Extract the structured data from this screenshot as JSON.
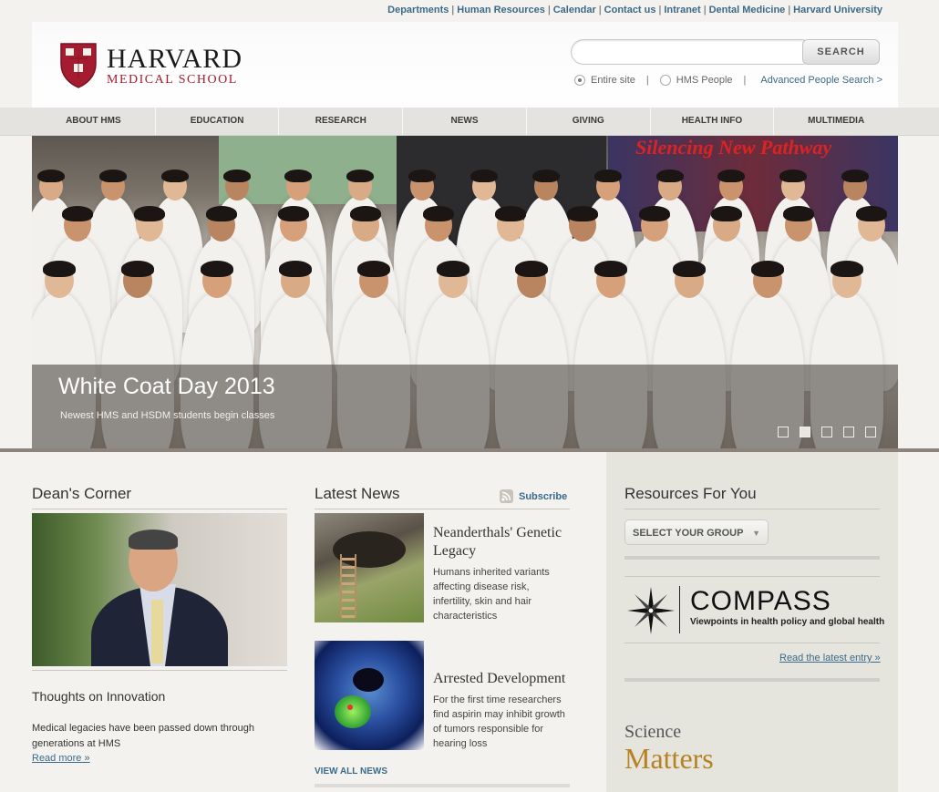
{
  "utility_links": [
    "Departments",
    "Human Resources",
    "Calendar",
    "Contact us",
    "Intranet",
    "Dental Medicine",
    "Harvard University"
  ],
  "logo": {
    "line1": "HARVARD",
    "line2": "MEDICAL SCHOOL",
    "shield_text": "VE RI TAS"
  },
  "search": {
    "placeholder": "",
    "button": "SEARCH",
    "scope_entire": "Entire site",
    "scope_people": "HMS People",
    "advanced": "Advanced People Search >"
  },
  "nav": [
    "ABOUT HMS",
    "EDUCATION",
    "RESEARCH",
    "NEWS",
    "GIVING",
    "HEALTH INFO",
    "MULTIMEDIA"
  ],
  "hero": {
    "title": "White Coat Day 2013",
    "subtitle": "Newest HMS and HSDM students begin classes",
    "banner_text": "Silencing New Pathway",
    "slide_count": 5,
    "active_slide": 2
  },
  "deans_corner": {
    "title": "Dean's Corner",
    "subtitle": "Thoughts on Innovation",
    "text": "Medical legacies have been passed down through generations at HMS",
    "link": "Read more »"
  },
  "latest_news": {
    "title": "Latest News",
    "subscribe": "Subscribe",
    "items": [
      {
        "headline": "Neanderthals' Genetic Legacy",
        "text": "Humans inherited variants affecting disease risk, infertility, skin and hair characteristics"
      },
      {
        "headline": "Arrested Development",
        "text": "For the first time researchers find aspirin may inhibit growth of tumors responsible for hearing loss"
      }
    ],
    "view_all": "VIEW ALL NEWS"
  },
  "resources": {
    "title": "Resources For You",
    "select": "SELECT YOUR GROUP",
    "compass_word": "COMPASS",
    "compass_tag": "Viewpoints in health policy and global health",
    "latest_entry": "Read the latest entry »",
    "science_line1": "Science",
    "science_line2": "Matters"
  },
  "colors": {
    "crimson": "#a51c30",
    "link": "#3a6b8c",
    "gold": "#b78223"
  }
}
